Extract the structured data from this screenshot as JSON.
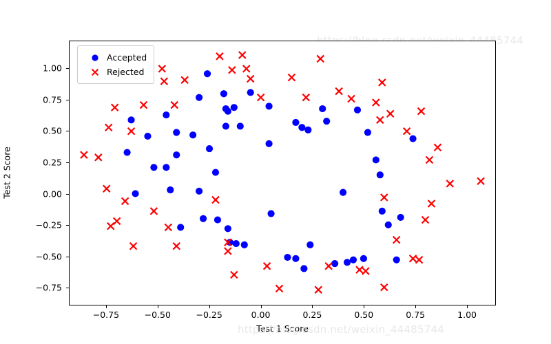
{
  "chart_data": {
    "type": "scatter",
    "title": "",
    "xlabel": "Test 1 Score",
    "ylabel": "Test 2 Score",
    "xlim": [
      -0.93,
      1.14
    ],
    "ylim": [
      -0.89,
      1.22
    ],
    "xticks": [
      -0.75,
      -0.5,
      -0.25,
      0.0,
      0.25,
      0.5,
      0.75,
      1.0
    ],
    "xticklabels": [
      "−0.75",
      "−0.50",
      "−0.25",
      "0.00",
      "0.25",
      "0.50",
      "0.75",
      "1.00"
    ],
    "yticks": [
      -0.75,
      -0.5,
      -0.25,
      0.0,
      0.25,
      0.5,
      0.75,
      1.0
    ],
    "yticklabels": [
      "−0.75",
      "−0.50",
      "−0.25",
      "0.00",
      "0.25",
      "0.50",
      "0.75",
      "1.00"
    ],
    "grid": false,
    "legend_position": "upper left",
    "series": [
      {
        "name": "Accepted",
        "marker": "circle",
        "color": "#0000ff",
        "points": [
          [
            -0.63,
            0.59
          ],
          [
            -0.65,
            0.33
          ],
          [
            -0.55,
            0.46
          ],
          [
            -0.61,
            0.0
          ],
          [
            -0.52,
            0.21
          ],
          [
            -0.46,
            0.63
          ],
          [
            -0.46,
            0.21
          ],
          [
            -0.44,
            0.03
          ],
          [
            -0.41,
            0.49
          ],
          [
            -0.41,
            0.31
          ],
          [
            -0.39,
            -0.27
          ],
          [
            -0.33,
            0.47
          ],
          [
            -0.3,
            0.77
          ],
          [
            -0.3,
            0.02
          ],
          [
            -0.28,
            -0.2
          ],
          [
            -0.26,
            0.96
          ],
          [
            -0.25,
            0.36
          ],
          [
            -0.22,
            0.17
          ],
          [
            -0.21,
            -0.21
          ],
          [
            -0.18,
            0.8
          ],
          [
            -0.17,
            0.68
          ],
          [
            -0.17,
            0.54
          ],
          [
            -0.16,
            0.66
          ],
          [
            -0.16,
            -0.28
          ],
          [
            -0.15,
            -0.39
          ],
          [
            -0.13,
            0.69
          ],
          [
            -0.12,
            -0.4
          ],
          [
            -0.1,
            0.54
          ],
          [
            -0.08,
            -0.41
          ],
          [
            -0.05,
            0.81
          ],
          [
            0.04,
            0.7
          ],
          [
            0.04,
            0.4
          ],
          [
            0.05,
            -0.16
          ],
          [
            0.13,
            -0.51
          ],
          [
            0.17,
            0.57
          ],
          [
            0.17,
            -0.52
          ],
          [
            0.2,
            0.53
          ],
          [
            0.21,
            -0.6
          ],
          [
            0.23,
            0.51
          ],
          [
            0.24,
            -0.41
          ],
          [
            0.3,
            0.68
          ],
          [
            0.32,
            0.58
          ],
          [
            0.36,
            -0.56
          ],
          [
            0.4,
            0.01
          ],
          [
            0.42,
            -0.55
          ],
          [
            0.45,
            -0.53
          ],
          [
            0.47,
            0.67
          ],
          [
            0.5,
            -0.52
          ],
          [
            0.52,
            0.49
          ],
          [
            0.56,
            0.27
          ],
          [
            0.58,
            0.15
          ],
          [
            0.59,
            -0.14
          ],
          [
            0.62,
            -0.25
          ],
          [
            0.66,
            -0.53
          ],
          [
            0.68,
            -0.19
          ],
          [
            0.74,
            0.44
          ]
        ]
      },
      {
        "name": "Rejected",
        "marker": "x",
        "color": "#ff0000",
        "points": [
          [
            -0.86,
            0.31
          ],
          [
            -0.79,
            0.29
          ],
          [
            -0.75,
            0.04
          ],
          [
            -0.74,
            0.53
          ],
          [
            -0.73,
            -0.26
          ],
          [
            -0.71,
            0.69
          ],
          [
            -0.7,
            -0.22
          ],
          [
            -0.66,
            -0.06
          ],
          [
            -0.63,
            0.5
          ],
          [
            -0.62,
            -0.42
          ],
          [
            -0.57,
            0.71
          ],
          [
            -0.52,
            -0.14
          ],
          [
            -0.48,
            1.0
          ],
          [
            -0.47,
            0.9
          ],
          [
            -0.45,
            -0.27
          ],
          [
            -0.42,
            0.71
          ],
          [
            -0.41,
            -0.42
          ],
          [
            -0.37,
            0.91
          ],
          [
            -0.22,
            -0.05
          ],
          [
            -0.2,
            1.1
          ],
          [
            -0.16,
            -0.39
          ],
          [
            -0.16,
            -0.46
          ],
          [
            -0.14,
            0.99
          ],
          [
            -0.13,
            -0.65
          ],
          [
            -0.09,
            1.11
          ],
          [
            -0.07,
            1.0
          ],
          [
            -0.05,
            0.92
          ],
          [
            0.0,
            0.77
          ],
          [
            0.03,
            -0.58
          ],
          [
            0.09,
            -0.76
          ],
          [
            0.15,
            0.93
          ],
          [
            0.22,
            0.77
          ],
          [
            0.28,
            -0.77
          ],
          [
            0.29,
            1.08
          ],
          [
            0.33,
            -0.58
          ],
          [
            0.38,
            0.82
          ],
          [
            0.44,
            0.76
          ],
          [
            0.48,
            -0.61
          ],
          [
            0.51,
            -0.62
          ],
          [
            0.56,
            0.73
          ],
          [
            0.58,
            0.59
          ],
          [
            0.59,
            0.89
          ],
          [
            0.6,
            -0.03
          ],
          [
            0.6,
            -0.75
          ],
          [
            0.63,
            0.64
          ],
          [
            0.66,
            -0.37
          ],
          [
            0.71,
            0.5
          ],
          [
            0.74,
            -0.52
          ],
          [
            0.77,
            -0.53
          ],
          [
            0.78,
            0.66
          ],
          [
            0.8,
            -0.21
          ],
          [
            0.82,
            0.27
          ],
          [
            0.83,
            -0.08
          ],
          [
            0.86,
            0.37
          ],
          [
            0.92,
            0.08
          ],
          [
            1.07,
            0.1
          ]
        ]
      }
    ]
  },
  "legend": {
    "items": [
      {
        "label": "Accepted",
        "marker": "circle",
        "color": "#0000ff"
      },
      {
        "label": "Rejected",
        "marker": "x",
        "color": "#ff0000"
      }
    ]
  },
  "watermark": {
    "bottom": "https://blog.csdn.net/weixin_44485744",
    "top": "https://blog.csdn.net/weixin_44485744"
  },
  "colors": {
    "accepted": "#0000ff",
    "rejected": "#ff0000",
    "axis": "#000000",
    "background": "#ffffff",
    "watermark": "#e8e8e8"
  }
}
